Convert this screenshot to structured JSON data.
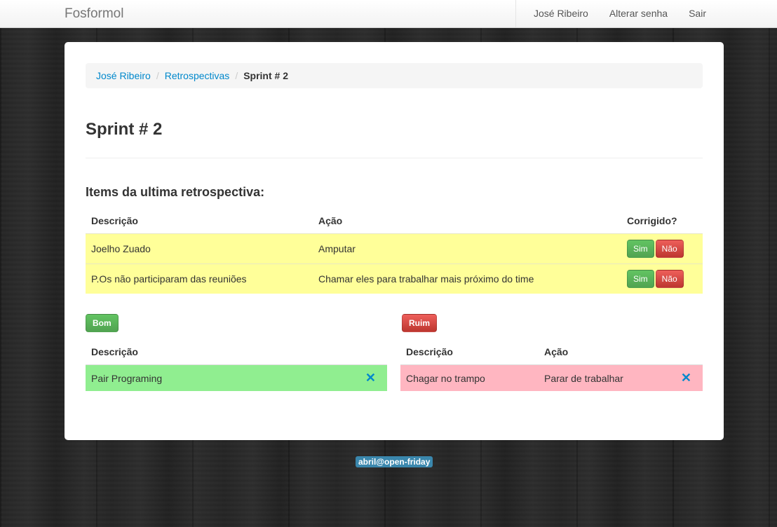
{
  "navbar": {
    "brand": "Fosformol",
    "links": [
      "José Ribeiro",
      "Alterar senha",
      "Sair"
    ]
  },
  "breadcrumb": {
    "items": [
      "José Ribeiro",
      "Retrospectivas"
    ],
    "divider": "/",
    "active": "Sprint # 2"
  },
  "page_title": "Sprint # 2",
  "section_title": "Items da ultima retrospectiva:",
  "items_table": {
    "headers": [
      "Descrição",
      "Ação",
      "Corrigido?"
    ],
    "rows": [
      {
        "descricao": "Joelho Zuado",
        "acao": "Amputar",
        "sim": "Sim",
        "nao": "Não"
      },
      {
        "descricao": "P.Os não participaram das reuniões",
        "acao": "Chamar eles para trabalhar mais próximo do time",
        "sim": "Sim",
        "nao": "Não"
      }
    ],
    "row_color": "#ffff99"
  },
  "bom": {
    "button_label": "Bom",
    "headers": [
      "Descrição"
    ],
    "rows": [
      {
        "descricao": "Pair Programing",
        "remove": "✕"
      }
    ],
    "row_color": "#90ee90"
  },
  "ruim": {
    "button_label": "Ruim",
    "headers": [
      "Descrição",
      "Ação"
    ],
    "rows": [
      {
        "descricao": "Chagar no trampo",
        "acao": "Parar de trabalhar",
        "remove": "✕"
      }
    ],
    "row_color": "#ffb6c1"
  },
  "footer": {
    "badge": "abril@open-friday"
  },
  "colors": {
    "link": "#0088cc",
    "success": "#51a351",
    "danger": "#bd362f"
  }
}
